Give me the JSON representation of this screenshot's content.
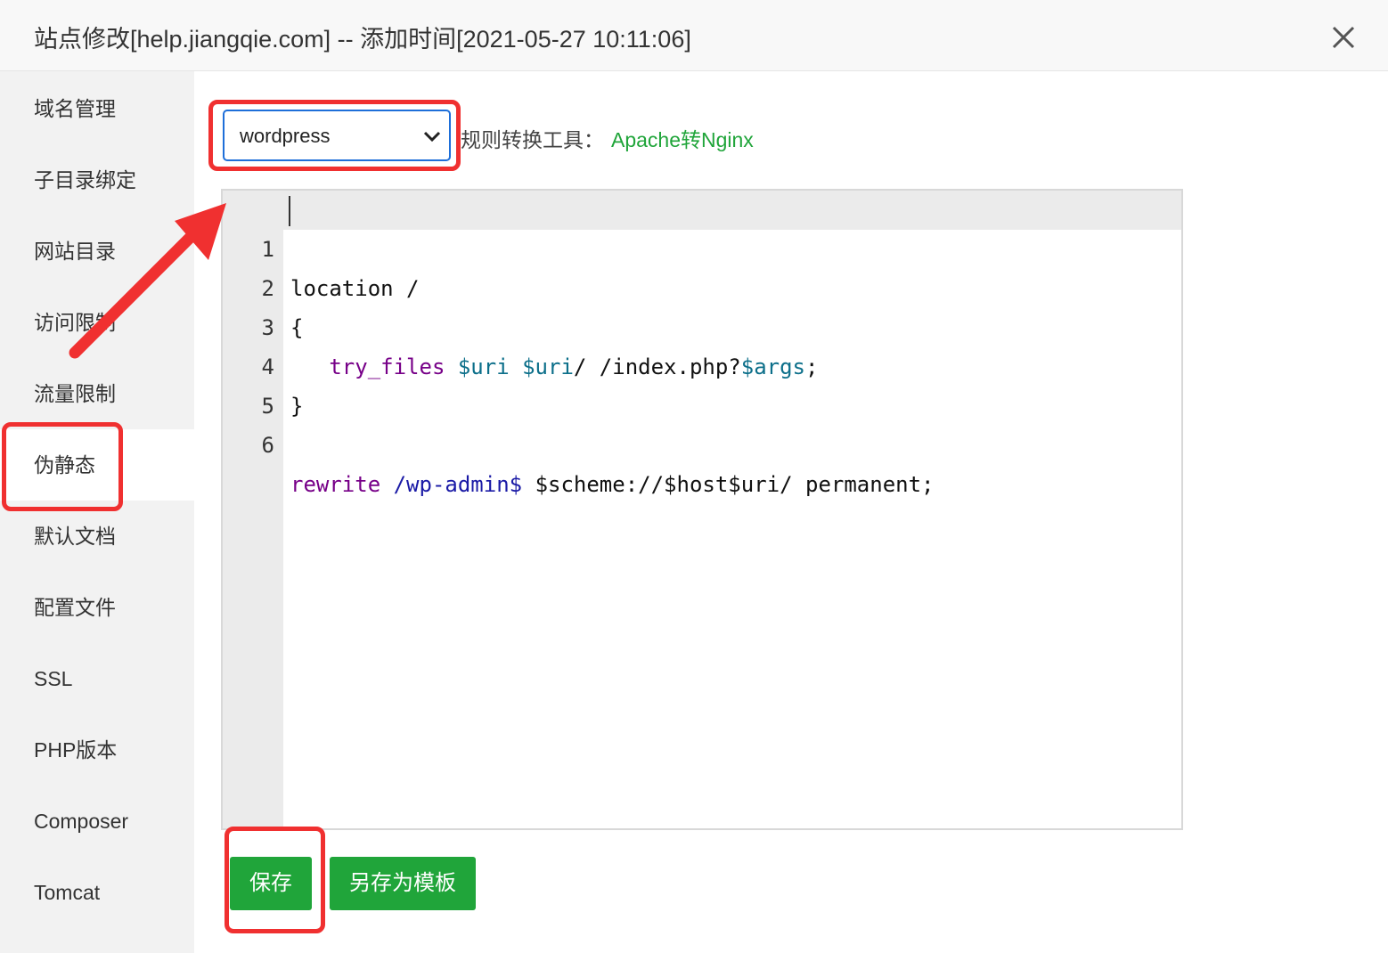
{
  "dialog": {
    "title": "站点修改[help.jiangqie.com] -- 添加时间[2021-05-27 10:11:06]",
    "close_icon": "close-icon"
  },
  "sidebar": {
    "items": [
      {
        "label": "域名管理"
      },
      {
        "label": "子目录绑定"
      },
      {
        "label": "网站目录"
      },
      {
        "label": "访问限制"
      },
      {
        "label": "流量限制"
      },
      {
        "label": "伪静态",
        "active": true
      },
      {
        "label": "默认文档"
      },
      {
        "label": "配置文件"
      },
      {
        "label": "SSL"
      },
      {
        "label": "PHP版本"
      },
      {
        "label": "Composer"
      },
      {
        "label": "Tomcat"
      }
    ]
  },
  "rewrite": {
    "template_select": {
      "value": "wordpress"
    },
    "tool_label": "规则转换工具：",
    "tool_link": "Apache转Nginx"
  },
  "editor": {
    "line_numbers": [
      "1",
      "2",
      "3",
      "4",
      "5",
      "6"
    ],
    "tokens": {
      "l1": "location /",
      "l2": "{",
      "l3_indent": "   ",
      "l3_kw": "try_files",
      "l3_v1": "$uri",
      "l3_v2": "$uri",
      "l3_mid": "/ /index.php?",
      "l3_v3": "$args",
      "l3_end": ";",
      "l4": "}",
      "l6_kw": "rewrite",
      "l6_re": "/wp-admin$",
      "l6_rest": "$scheme://$host$uri/ permanent;"
    }
  },
  "buttons": {
    "save": "保存",
    "save_as_template": "另存为模板"
  },
  "colors": {
    "accent_green": "#20a53a",
    "annotation_red": "#f03030",
    "select_border": "#1e6fd9"
  }
}
